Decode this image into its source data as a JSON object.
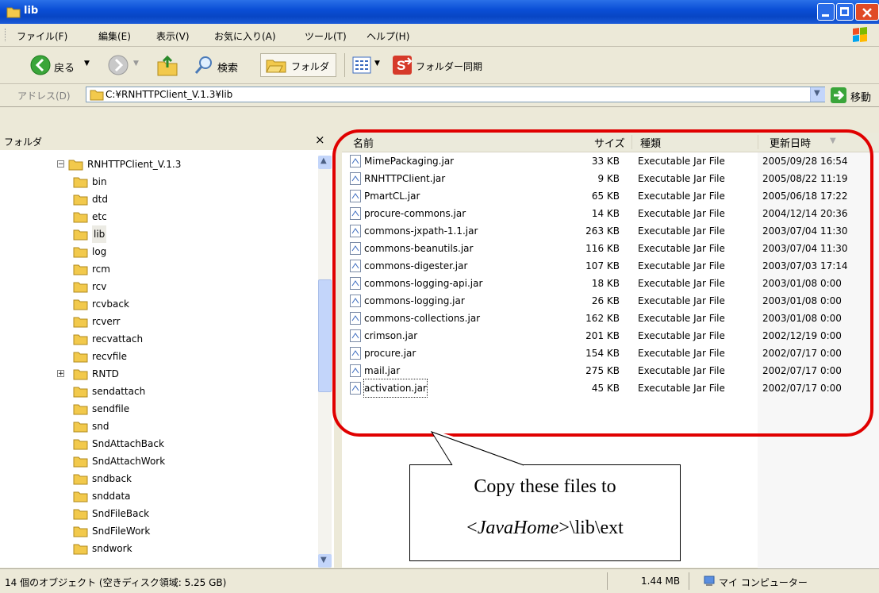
{
  "window": {
    "title": "lib"
  },
  "menu": [
    "ファイル(F)",
    "編集(E)",
    "表示(V)",
    "お気に入り(A)",
    "ツール(T)",
    "ヘルプ(H)"
  ],
  "toolbar": {
    "back_label": "戻る",
    "search_label": "検索",
    "folders_label": "フォルダ",
    "sync_label": "フォルダー同期"
  },
  "address": {
    "label": "アドレス(D)",
    "path": "C:¥RNHTTPClient_V.1.3¥lib",
    "go_label": "移動"
  },
  "folder_pane": {
    "title": "フォルダ",
    "close_glyph": "×"
  },
  "tree": {
    "root": "RNHTTPClient_V.1.3",
    "items": [
      "bin",
      "dtd",
      "etc",
      "lib",
      "log",
      "rcm",
      "rcv",
      "rcvback",
      "rcverr",
      "recvattach",
      "recvfile",
      "RNTD",
      "sendattach",
      "sendfile",
      "snd",
      "SndAttachBack",
      "SndAttachWork",
      "sndback",
      "snddata",
      "SndFileBack",
      "SndFileWork",
      "sndwork"
    ]
  },
  "columns": {
    "name": "名前",
    "size": "サイズ",
    "type": "種類",
    "modified": "更新日時"
  },
  "files": [
    {
      "name": "MimePackaging.jar",
      "size": "33 KB",
      "type": "Executable Jar File",
      "date": "2005/09/28 16:54"
    },
    {
      "name": "RNHTTPClient.jar",
      "size": "9 KB",
      "type": "Executable Jar File",
      "date": "2005/08/22 11:19"
    },
    {
      "name": "PmartCL.jar",
      "size": "65 KB",
      "type": "Executable Jar File",
      "date": "2005/06/18 17:22"
    },
    {
      "name": "procure-commons.jar",
      "size": "14 KB",
      "type": "Executable Jar File",
      "date": "2004/12/14 20:36"
    },
    {
      "name": "commons-jxpath-1.1.jar",
      "size": "263 KB",
      "type": "Executable Jar File",
      "date": "2003/07/04 11:30"
    },
    {
      "name": "commons-beanutils.jar",
      "size": "116 KB",
      "type": "Executable Jar File",
      "date": "2003/07/04 11:30"
    },
    {
      "name": "commons-digester.jar",
      "size": "107 KB",
      "type": "Executable Jar File",
      "date": "2003/07/03 17:14"
    },
    {
      "name": "commons-logging-api.jar",
      "size": "18 KB",
      "type": "Executable Jar File",
      "date": "2003/01/08 0:00"
    },
    {
      "name": "commons-logging.jar",
      "size": "26 KB",
      "type": "Executable Jar File",
      "date": "2003/01/08 0:00"
    },
    {
      "name": "commons-collections.jar",
      "size": "162 KB",
      "type": "Executable Jar File",
      "date": "2003/01/08 0:00"
    },
    {
      "name": "crimson.jar",
      "size": "201 KB",
      "type": "Executable Jar File",
      "date": "2002/12/19 0:00"
    },
    {
      "name": "procure.jar",
      "size": "154 KB",
      "type": "Executable Jar File",
      "date": "2002/07/17 0:00"
    },
    {
      "name": "mail.jar",
      "size": "275 KB",
      "type": "Executable Jar File",
      "date": "2002/07/17 0:00"
    },
    {
      "name": "activation.jar",
      "size": "45 KB",
      "type": "Executable Jar File",
      "date": "2002/07/17 0:00"
    }
  ],
  "callout": {
    "line1": "Copy these files to",
    "line2_pre": "<",
    "line2_em": "JavaHome",
    "line2_post": ">\\lib\\ext"
  },
  "status": {
    "objects": "14 個のオブジェクト (空きディスク領域: 5.25 GB)",
    "size": "1.44 MB",
    "zone": "マイ コンピューター"
  },
  "colors": {
    "title_bar": "#0a4fd6",
    "highlight": "#e00000",
    "folder_icon": "#f2c94c"
  }
}
